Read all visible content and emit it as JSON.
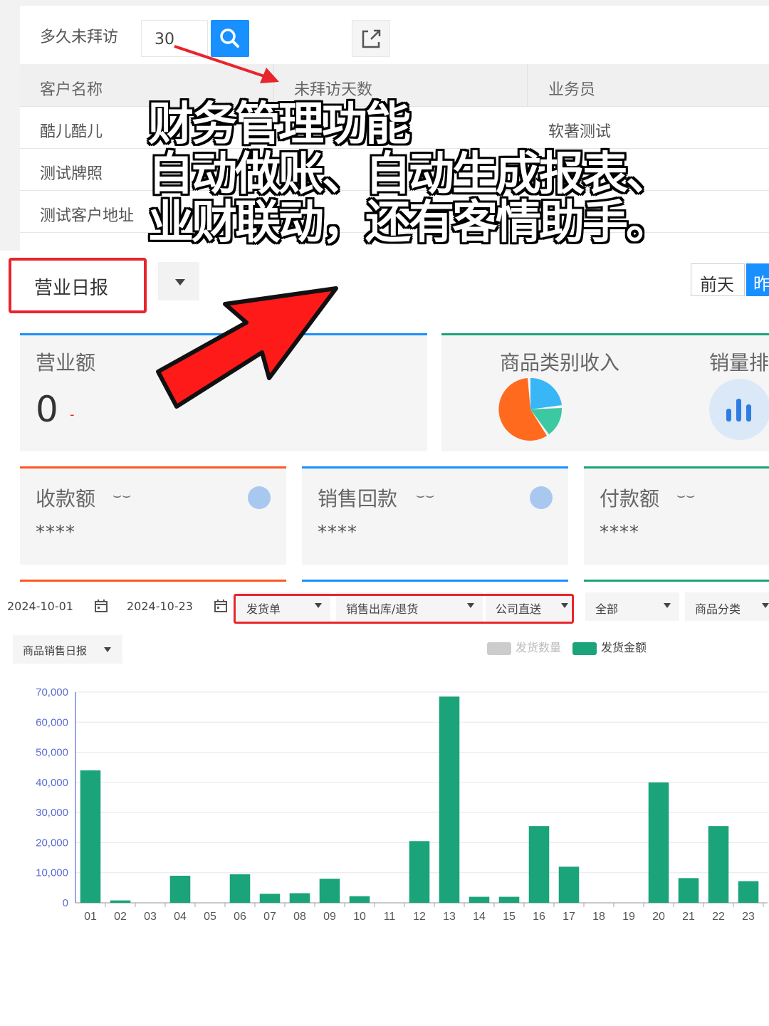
{
  "visit": {
    "label": "多久未拜访",
    "days_value": "30",
    "table_headers": [
      "客户名称",
      "未拜访天数",
      "业务员"
    ],
    "rows": [
      {
        "customer": "酷儿酷儿",
        "salesman": "软著测试"
      },
      {
        "customer": "测试牌照",
        "salesman": ""
      },
      {
        "customer": "测试客户地址",
        "salesman": ""
      }
    ]
  },
  "overlay": {
    "line1": "财务管理功能",
    "line2": "自动做账、自动生成报表、",
    "line3": "业财联动，还有客情助手。"
  },
  "report": {
    "select_label": "营业日报",
    "day_buttons": [
      "前天",
      "昨"
    ],
    "revenue_label": "营业额",
    "revenue_value": "0",
    "revenue_dash": "-",
    "category_income_label": "商品类别收入",
    "sales_rank_label": "销量排",
    "receipt_label": "收款额",
    "sales_return_label": "销售回款",
    "payment_label": "付款额",
    "masked_value": "****"
  },
  "filters": {
    "start_date": "2024-10-01",
    "end_date": "2024-10-23",
    "doc_type": "发货单",
    "out_type": "销售出库/退货",
    "delivery": "公司直送",
    "scope": "全部",
    "category": "商品分类"
  },
  "chart_selector": "商品销售日报",
  "colors": {
    "accent_blue": "#1890ff",
    "highlight_red": "#e8252b",
    "bar_green": "#1ba37a",
    "legend_gray": "#cccccc"
  },
  "chart_data": {
    "type": "bar",
    "categories": [
      "01",
      "02",
      "03",
      "04",
      "05",
      "06",
      "07",
      "08",
      "09",
      "10",
      "11",
      "12",
      "13",
      "14",
      "15",
      "16",
      "17",
      "18",
      "19",
      "20",
      "21",
      "22",
      "23"
    ],
    "series": [
      {
        "name": "发货数量",
        "values": [],
        "hidden": true
      },
      {
        "name": "发货金额",
        "values": [
          44000,
          800,
          0,
          9000,
          0,
          9500,
          3000,
          3200,
          8000,
          2200,
          0,
          20500,
          68500,
          2000,
          2000,
          25500,
          12000,
          0,
          0,
          40000,
          8200,
          25500,
          7200
        ]
      }
    ],
    "ylim": [
      0,
      70000
    ],
    "yticks": [
      "0",
      "10,000",
      "20,000",
      "30,000",
      "40,000",
      "50,000",
      "60,000",
      "70,000"
    ],
    "grid": true,
    "legend_position": "top-right"
  }
}
